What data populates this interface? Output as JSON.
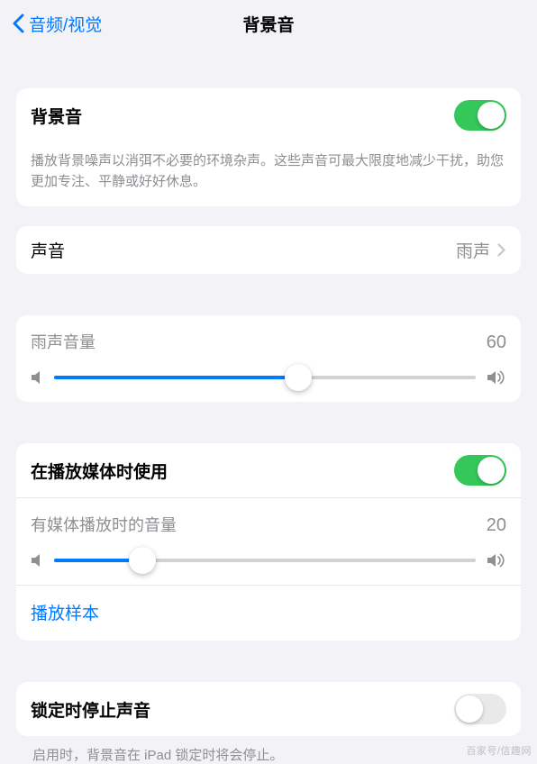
{
  "header": {
    "back_label": "音频/视觉",
    "title": "背景音"
  },
  "master": {
    "label": "背景音",
    "on": true,
    "desc": "播放背景噪声以消弭不必要的环境杂声。这些声音可最大限度地减少干扰，助您更加专注、平静或好好休息。"
  },
  "sound": {
    "label": "声音",
    "value": "雨声"
  },
  "volume_main": {
    "label": "雨声音量",
    "value": 60
  },
  "media": {
    "label": "在播放媒体时使用",
    "on": true,
    "volume_label": "有媒体播放时的音量",
    "volume_value": 20,
    "sample_label": "播放样本"
  },
  "lock": {
    "label": "锁定时停止声音",
    "on": false,
    "desc": "启用时，背景音在 iPad 锁定时将会停止。"
  },
  "watermark": "百家号/信趣网"
}
